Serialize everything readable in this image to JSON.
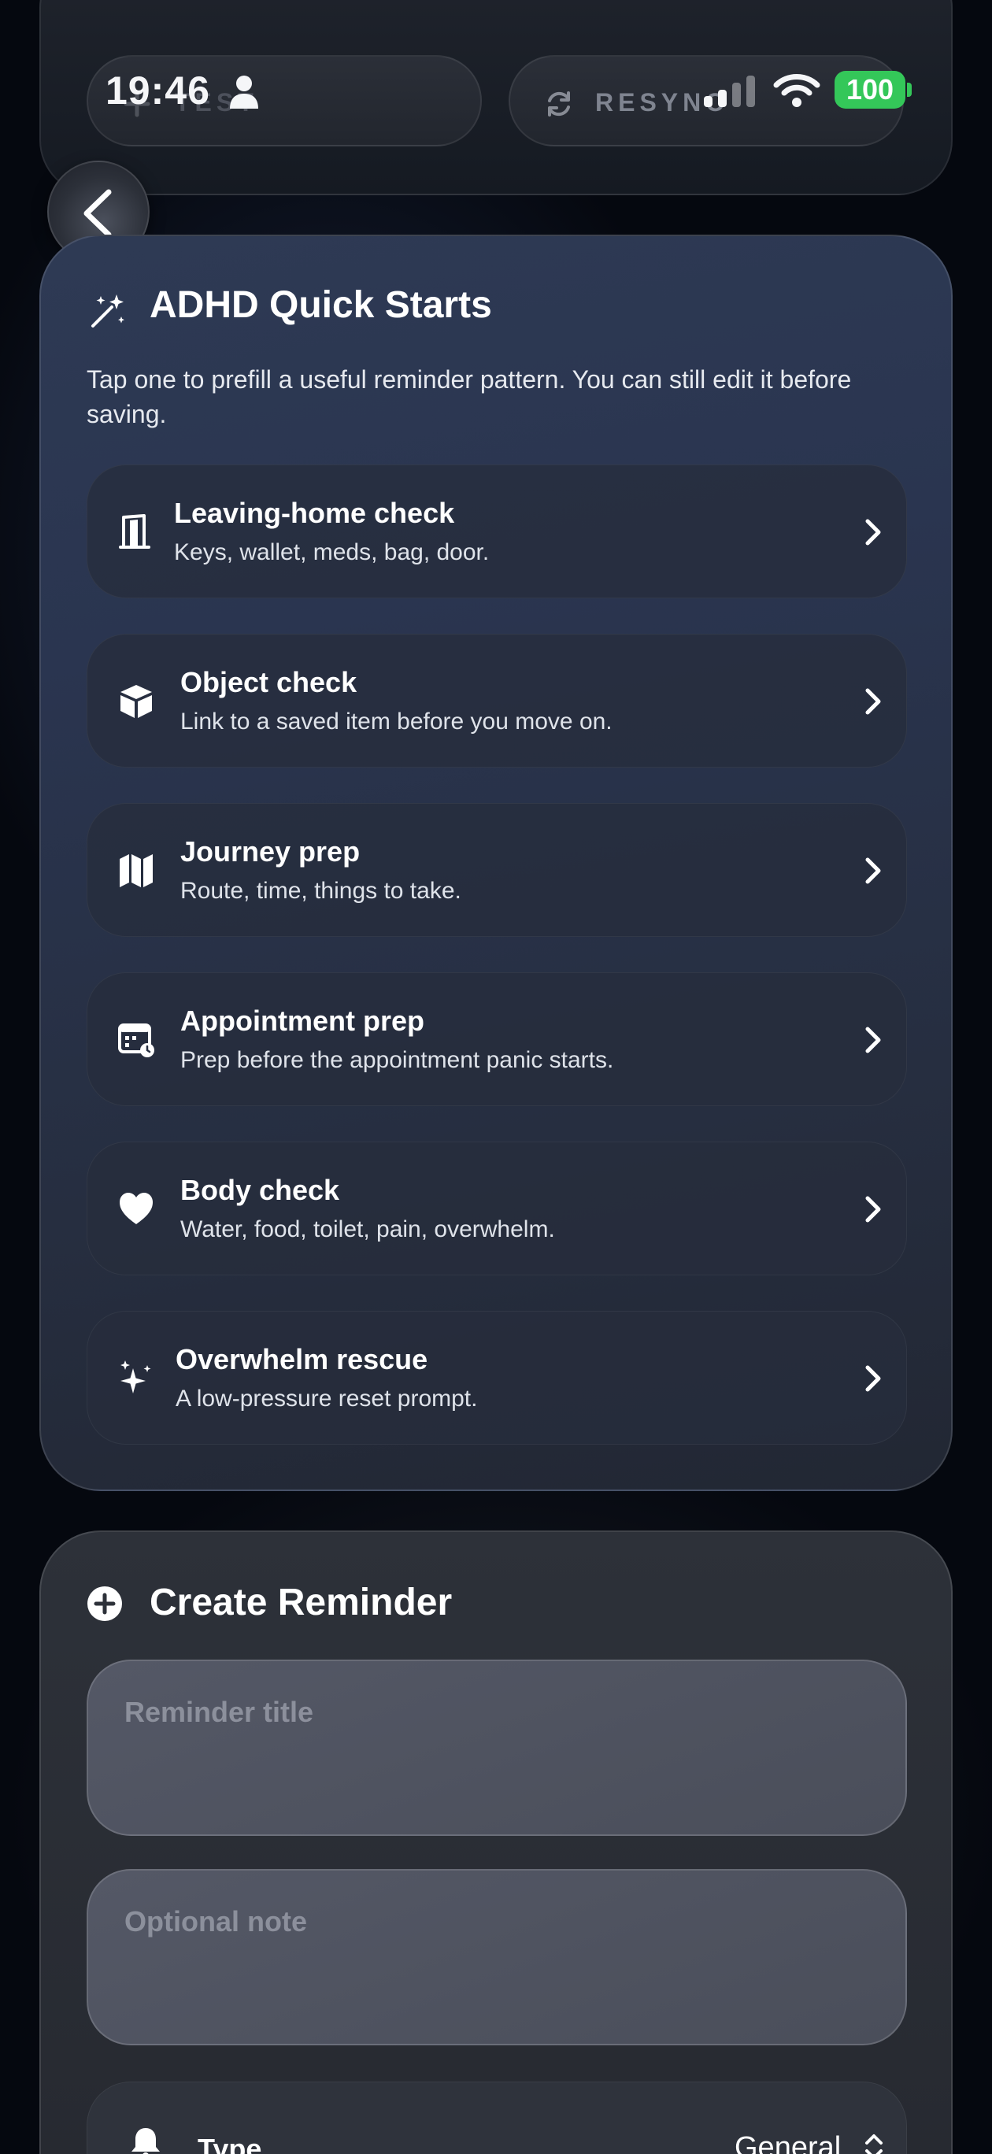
{
  "status_bar": {
    "time": "19:46",
    "battery": "100"
  },
  "top_card": {
    "test_label": "TEST",
    "resync_label": "RESYNC"
  },
  "quick_starts": {
    "title": "ADHD Quick Starts",
    "description": "Tap one to prefill a useful reminder pattern. You can still edit it before saving.",
    "items": [
      {
        "title": "Leaving-home check",
        "subtitle": "Keys, wallet, meds, bag, door.",
        "icon": "door-icon"
      },
      {
        "title": "Object check",
        "subtitle": "Link to a saved item before you move on.",
        "icon": "box-icon"
      },
      {
        "title": "Journey prep",
        "subtitle": "Route, time, things to take.",
        "icon": "map-icon"
      },
      {
        "title": "Appointment prep",
        "subtitle": "Prep before the appointment panic starts.",
        "icon": "calendar-clock-icon"
      },
      {
        "title": "Body check",
        "subtitle": "Water, food, toilet, pain, overwhelm.",
        "icon": "heart-icon"
      },
      {
        "title": "Overwhelm rescue",
        "subtitle": "A low-pressure reset prompt.",
        "icon": "sparkles-icon"
      }
    ]
  },
  "create_reminder": {
    "title": "Create Reminder",
    "title_placeholder": "Reminder title",
    "note_placeholder": "Optional note",
    "type_label": "Type",
    "type_value": "General"
  },
  "colors": {
    "battery_green": "#34c759",
    "quick_card_bg": "#2a3550",
    "create_card_bg": "#2d3139"
  }
}
